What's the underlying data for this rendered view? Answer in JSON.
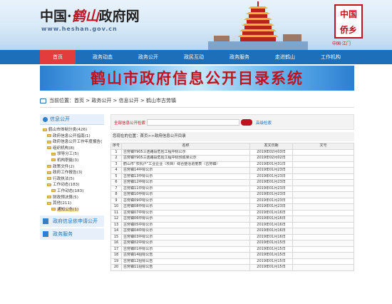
{
  "header": {
    "logo_left": "中国·",
    "logo_mid": "鹤山",
    "logo_right": "政府网",
    "url": "www.heshan.gov.cn",
    "badge_line1": "中国",
    "badge_line2": "侨乡",
    "badge_sub": "中国·江门"
  },
  "nav": [
    "首页",
    "政务动态",
    "政务公开",
    "政民互动",
    "政务服务",
    "走进鹤山",
    "工作机构"
  ],
  "system_title": "鹤山市政府信息公开目录系统",
  "breadcrumb": "当前位置：首页 > 政务公开 > 信息公开 > 鹤山市古劳镇",
  "sidebar": {
    "header": "信息公开",
    "tree": [
      "鹤山市体制分类(426)",
      "政府信息公开指南(1)",
      "政府信息公开工作年度报告(",
      "组织机构(8)",
      "领导分工(5)",
      "机构职能(3)",
      "政策文件(2)",
      "政府工作报告(3)",
      "行政执法(5)",
      "工作动态(183)",
      "工作动态(183)",
      "财政预决算(5)",
      "其他(211)",
      "通知公告(1)"
    ],
    "btn_request": "政府信息依申请公开",
    "btn_service": "政务服务"
  },
  "search": {
    "label": "全部信息公开检索",
    "advanced": "高级检索"
  },
  "location": "您现在的位置：首页>>政府信息公开目录",
  "table": {
    "headers": [
      "序号",
      "名称",
      "发文日期",
      "文号"
    ],
    "rows": [
      [
        "1",
        "古劳镇Y905三连路段危险工程中标公示",
        "2019年02月03日",
        ""
      ],
      [
        "2",
        "古劳镇Y905三连路段危险工程中标预成果公示",
        "2019年02月02日",
        ""
      ],
      [
        "3",
        "鹤山市“农机户”工业企业（项目）综合整治进度表（古劳镇）",
        "2019年01月31日",
        ""
      ],
      [
        "4",
        "古劳镇14中标公示",
        "2019年01月23日",
        ""
      ],
      [
        "5",
        "古劳镇13中标公示",
        "2019年01月23日",
        ""
      ],
      [
        "6",
        "古劳镇12中标公示",
        "2019年01月23日",
        ""
      ],
      [
        "7",
        "古劳镇11中标公示",
        "2019年01月23日",
        ""
      ],
      [
        "8",
        "古劳镇10中标公示",
        "2019年01月23日",
        ""
      ],
      [
        "9",
        "古劳镇09中标公示",
        "2019年01月23日",
        ""
      ],
      [
        "10",
        "古劳镇08中标公示",
        "2019年01月23日",
        ""
      ],
      [
        "11",
        "古劳镇07中标公示",
        "2019年01月16日",
        ""
      ],
      [
        "12",
        "古劳镇06中标公示",
        "2019年01月16日",
        ""
      ],
      [
        "13",
        "古劳镇05中标公示",
        "2019年01月16日",
        ""
      ],
      [
        "14",
        "古劳镇04中标公示",
        "2019年01月16日",
        ""
      ],
      [
        "15",
        "古劳镇03中标公示",
        "2019年01月16日",
        ""
      ],
      [
        "16",
        "古劳镇02中标公示",
        "2019年01月15日",
        ""
      ],
      [
        "17",
        "古劳镇01中标公示",
        "2019年01月15日",
        ""
      ],
      [
        "18",
        "古劳镇14招标公告",
        "2019年01月15日",
        ""
      ],
      [
        "19",
        "古劳镇12招标公告",
        "2019年01月15日",
        ""
      ],
      [
        "20",
        "古劳镇11招标公告",
        "2019年01月15日",
        ""
      ]
    ]
  },
  "colors": {
    "nav_blue": "#1e6fb9",
    "accent_red": "#c1121f",
    "nav_active": "#e23c3c"
  }
}
